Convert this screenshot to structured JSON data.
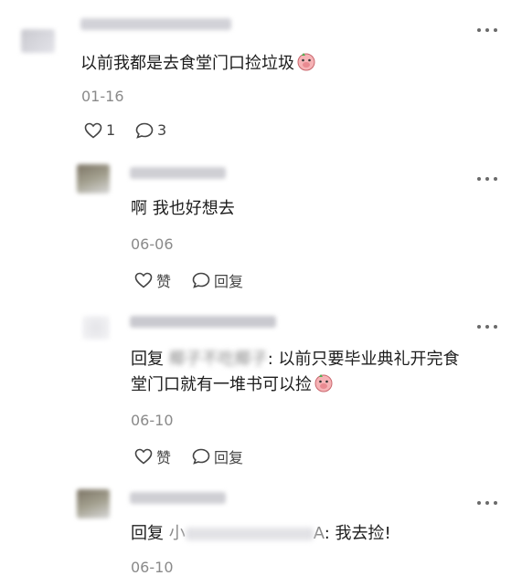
{
  "comments": [
    {
      "text": "以前我都是去食堂门口捡垃圾",
      "date": "01-16",
      "likes": "1",
      "replies": "3"
    },
    {
      "text": "啊 我也好想去",
      "date": "06-06",
      "like_label": "赞",
      "reply_label": "回复"
    },
    {
      "reply_prefix": "回复",
      "reply_to": "椰子不吃椰子",
      "text_line1": ": 以前只要毕业典礼开完食",
      "text_line2": "堂门口就有一堆书可以捡",
      "date": "06-10",
      "like_label": "赞",
      "reply_label": "回复"
    },
    {
      "reply_prefix": "回复",
      "reply_to": "小",
      "reply_to_suffix": "A",
      "text": ": 我去捡!",
      "date": "06-10"
    }
  ],
  "icons": {
    "like": "heart-icon",
    "reply": "speech-bubble-icon",
    "more": "more-dots-icon",
    "emoji": "crying-pig-emoji-icon"
  },
  "colors": {
    "text": "#1d1d1d",
    "meta": "#8a8a8a",
    "emoji_pink": "#f4a3a8"
  }
}
